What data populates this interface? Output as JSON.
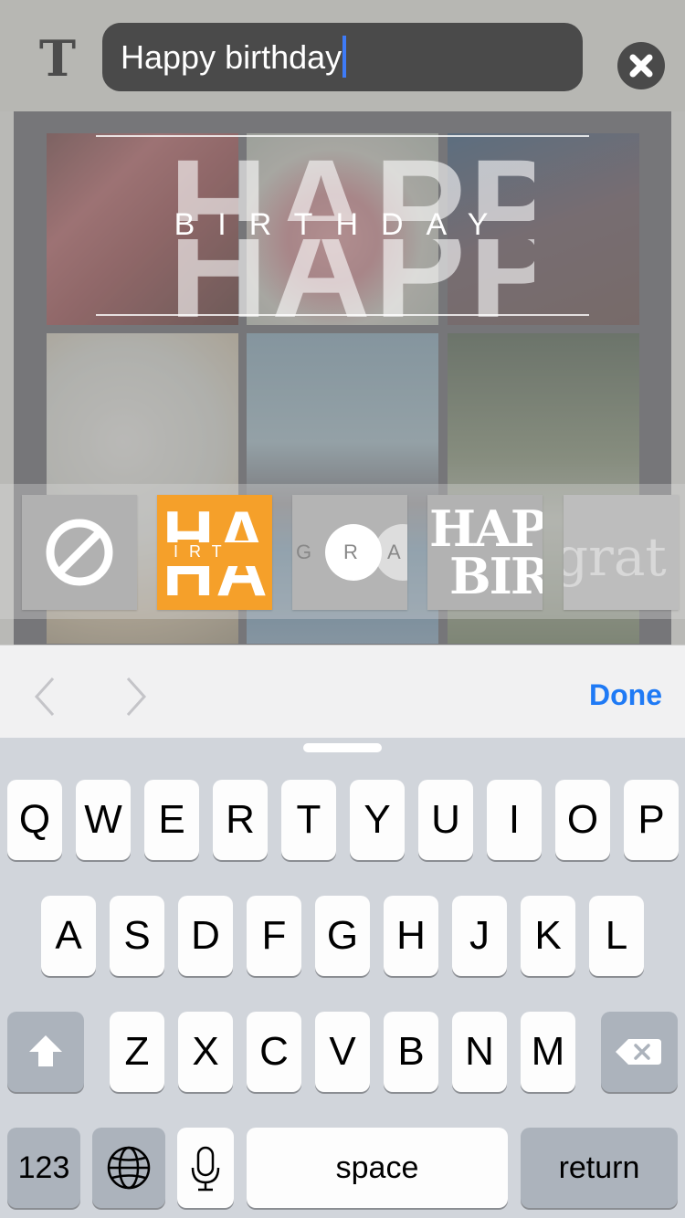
{
  "text_editor": {
    "format_icon": "text-format-icon",
    "value": "Happy birthday",
    "clear_icon": "clear-circle-icon"
  },
  "preview": {
    "big_word": "HAPPY",
    "middle_word": "BIRTHDAY"
  },
  "styles": [
    {
      "id": "none",
      "icon": "no-style-icon"
    },
    {
      "id": "happy",
      "top": "HAP",
      "middle": "IRT",
      "bottom": "HAP",
      "color": "#f5a02a"
    },
    {
      "id": "gra",
      "letters": [
        "G",
        "R",
        "A"
      ]
    },
    {
      "id": "hapbir",
      "line1": "HAP",
      "line2": "BIR"
    },
    {
      "id": "grat",
      "text": "grat"
    }
  ],
  "accessory": {
    "prev_icon": "chevron-left-icon",
    "next_icon": "chevron-right-icon",
    "done_label": "Done",
    "accent": "#1f7af5"
  },
  "keyboard": {
    "row1": [
      "Q",
      "W",
      "E",
      "R",
      "T",
      "Y",
      "U",
      "I",
      "O",
      "P"
    ],
    "row2": [
      "A",
      "S",
      "D",
      "F",
      "G",
      "H",
      "J",
      "K",
      "L"
    ],
    "row3": [
      "Z",
      "X",
      "C",
      "V",
      "B",
      "N",
      "M"
    ],
    "numbers_label": "123",
    "space_label": "space",
    "return_label": "return",
    "shift_icon": "shift-icon",
    "delete_icon": "backspace-icon",
    "globe_icon": "globe-icon",
    "mic_icon": "microphone-icon"
  }
}
